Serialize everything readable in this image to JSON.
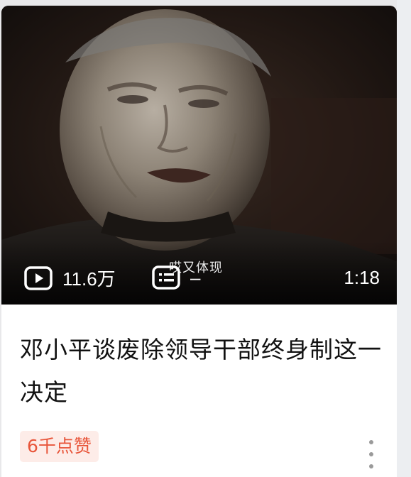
{
  "video": {
    "views": "11.6万",
    "views_icon": "play-icon",
    "subtitle_icon": "subtitle-icon",
    "subtitle_dash": "–",
    "duration": "1:18",
    "caption_text": "哎又体现"
  },
  "title": "邓小平谈废除领导干部终身制这一决定",
  "likes": "6千点赞",
  "more_icon": "more-vertical-icon",
  "colors": {
    "likes_text": "#e8553a",
    "likes_bg": "#fdece8",
    "title_text": "#111111",
    "background": "#e8e8ea"
  }
}
